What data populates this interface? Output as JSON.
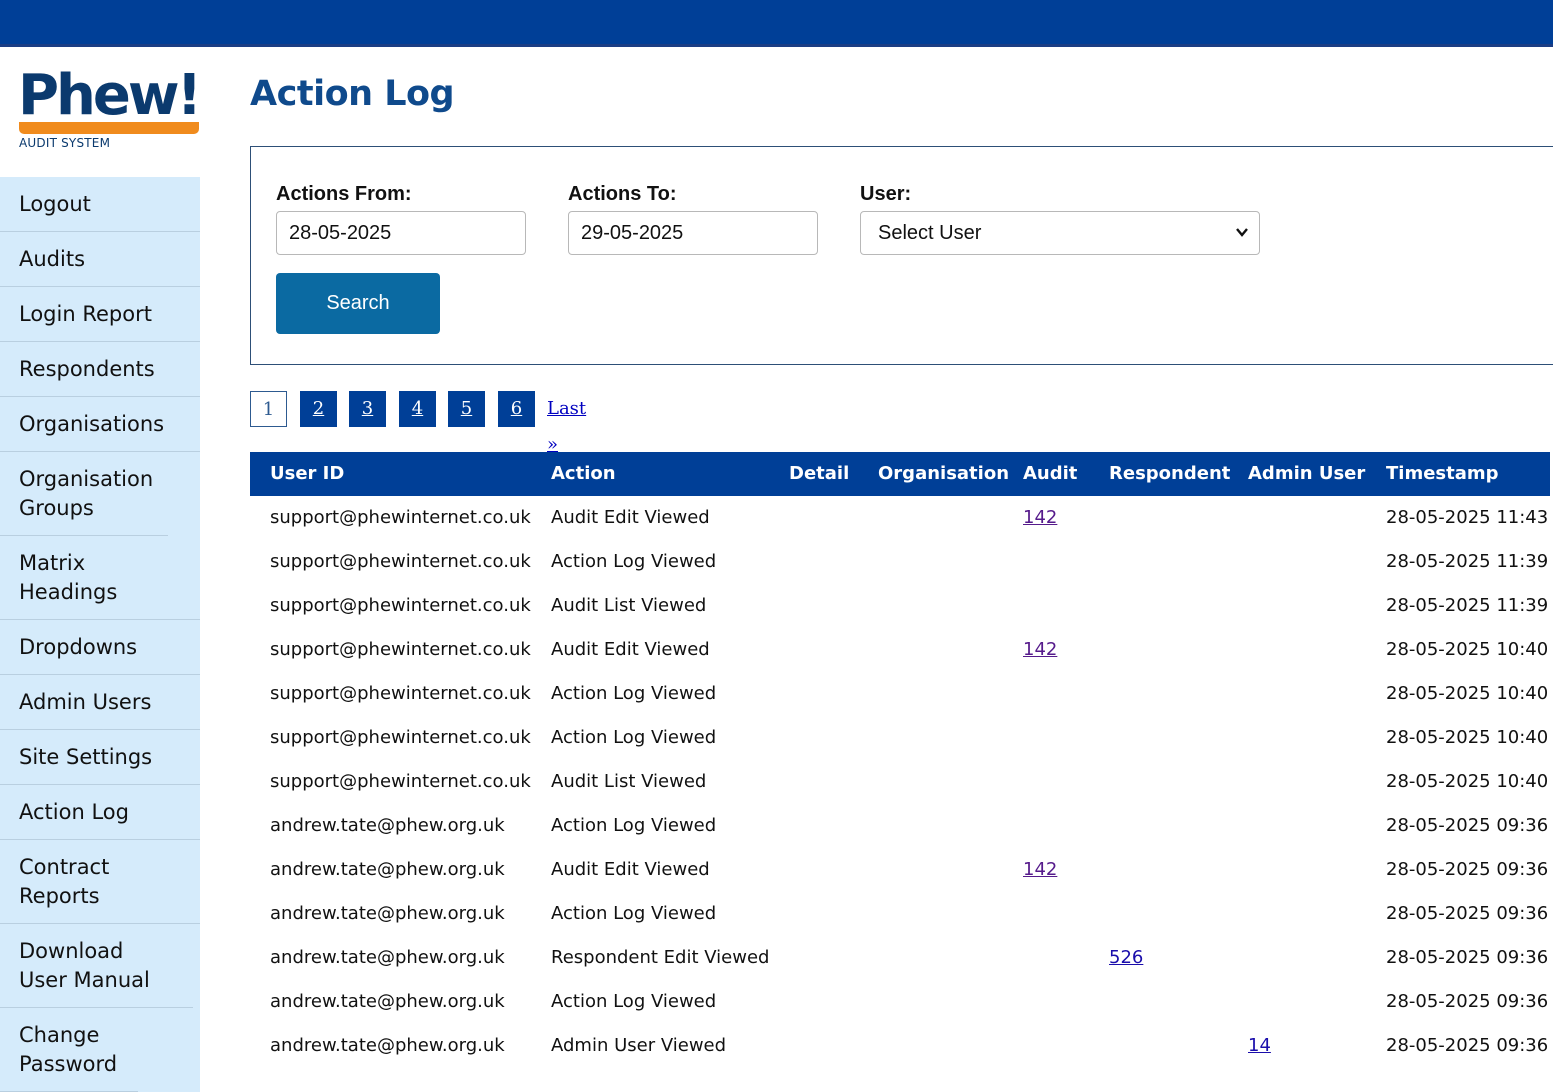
{
  "brand": {
    "logo_text": "Phew!",
    "logo_sub": "AUDIT SYSTEM"
  },
  "sidebar": {
    "items": [
      {
        "label": "Logout"
      },
      {
        "label": "Audits"
      },
      {
        "label": "Login Report"
      },
      {
        "label": "Respondents"
      },
      {
        "label": "Organisations"
      },
      {
        "label": "Organisation Groups"
      },
      {
        "label": "Matrix Headings"
      },
      {
        "label": "Dropdowns"
      },
      {
        "label": "Admin Users"
      },
      {
        "label": "Site Settings"
      },
      {
        "label": "Action Log"
      },
      {
        "label": "Contract Reports"
      },
      {
        "label": "Download User Manual"
      },
      {
        "label": "Change Password"
      }
    ]
  },
  "main": {
    "title": "Action Log"
  },
  "filters": {
    "from_label": "Actions From:",
    "from_value": "28-05-2025",
    "to_label": "Actions To:",
    "to_value": "29-05-2025",
    "user_label": "User:",
    "user_selected": "Select User",
    "search_label": "Search"
  },
  "pagination": {
    "current": "1",
    "pages": [
      "2",
      "3",
      "4",
      "5",
      "6"
    ],
    "last_label": "Last »"
  },
  "table": {
    "headers": [
      "User ID",
      "Action",
      "Detail",
      "Organisation",
      "Audit",
      "Respondent",
      "Admin User",
      "Timestamp (UTC)"
    ],
    "rows": [
      {
        "user": "support@phewinternet.co.uk",
        "action": "Audit Edit Viewed",
        "detail": "",
        "organisation": "",
        "audit": "142",
        "respondent": "",
        "admin_user": "",
        "timestamp": "28-05-2025 11:43"
      },
      {
        "user": "support@phewinternet.co.uk",
        "action": "Action Log Viewed",
        "detail": "",
        "organisation": "",
        "audit": "",
        "respondent": "",
        "admin_user": "",
        "timestamp": "28-05-2025 11:39"
      },
      {
        "user": "support@phewinternet.co.uk",
        "action": "Audit List Viewed",
        "detail": "",
        "organisation": "",
        "audit": "",
        "respondent": "",
        "admin_user": "",
        "timestamp": "28-05-2025 11:39"
      },
      {
        "user": "support@phewinternet.co.uk",
        "action": "Audit Edit Viewed",
        "detail": "",
        "organisation": "",
        "audit": "142",
        "respondent": "",
        "admin_user": "",
        "timestamp": "28-05-2025 10:40"
      },
      {
        "user": "support@phewinternet.co.uk",
        "action": "Action Log Viewed",
        "detail": "",
        "organisation": "",
        "audit": "",
        "respondent": "",
        "admin_user": "",
        "timestamp": "28-05-2025 10:40"
      },
      {
        "user": "support@phewinternet.co.uk",
        "action": "Action Log Viewed",
        "detail": "",
        "organisation": "",
        "audit": "",
        "respondent": "",
        "admin_user": "",
        "timestamp": "28-05-2025 10:40"
      },
      {
        "user": "support@phewinternet.co.uk",
        "action": "Audit List Viewed",
        "detail": "",
        "organisation": "",
        "audit": "",
        "respondent": "",
        "admin_user": "",
        "timestamp": "28-05-2025 10:40"
      },
      {
        "user": "andrew.tate@phew.org.uk",
        "action": "Action Log Viewed",
        "detail": "",
        "organisation": "",
        "audit": "",
        "respondent": "",
        "admin_user": "",
        "timestamp": "28-05-2025 09:36"
      },
      {
        "user": "andrew.tate@phew.org.uk",
        "action": "Audit Edit Viewed",
        "detail": "",
        "organisation": "",
        "audit": "142",
        "respondent": "",
        "admin_user": "",
        "timestamp": "28-05-2025 09:36"
      },
      {
        "user": "andrew.tate@phew.org.uk",
        "action": "Action Log Viewed",
        "detail": "",
        "organisation": "",
        "audit": "",
        "respondent": "",
        "admin_user": "",
        "timestamp": "28-05-2025 09:36"
      },
      {
        "user": "andrew.tate@phew.org.uk",
        "action": "Respondent Edit Viewed",
        "detail": "",
        "organisation": "",
        "audit": "",
        "respondent": "526",
        "admin_user": "",
        "timestamp": "28-05-2025 09:36"
      },
      {
        "user": "andrew.tate@phew.org.uk",
        "action": "Action Log Viewed",
        "detail": "",
        "organisation": "",
        "audit": "",
        "respondent": "",
        "admin_user": "",
        "timestamp": "28-05-2025 09:36"
      },
      {
        "user": "andrew.tate@phew.org.uk",
        "action": "Admin User Viewed",
        "detail": "",
        "organisation": "",
        "audit": "",
        "respondent": "",
        "admin_user": "14",
        "timestamp": "28-05-2025 09:36"
      }
    ]
  },
  "colors": {
    "header_blue": "#003f97",
    "sidebar_bg": "#d5ebfb",
    "logo_orange": "#f08b1d",
    "button_blue": "#0b6aa2"
  }
}
